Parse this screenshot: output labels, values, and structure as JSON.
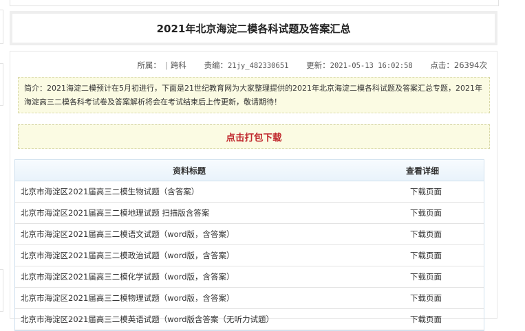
{
  "page": {
    "title": "2021年北京海淀二模各科试题及答案汇总"
  },
  "meta": {
    "belong_label": "所属：",
    "belong_value": "跨科",
    "editor_label": "责编：",
    "editor_value": "21jy_482330651",
    "updated_label": "更新：",
    "updated_value": "2021-05-13 16:02:58",
    "clicks_label": "点击：",
    "clicks_value": "26394次"
  },
  "intro": "简介：2021海淀二模预计在5月初进行，下面是21世纪教育网为大家整理提供的2021年北京海淀二模各科试题及答案汇总专题，2021年海淀高三二模各科考试卷及答案解析将会在考试结束后上传更新，敬请期待！",
  "download_label": "点击打包下载",
  "table": {
    "headers": [
      "资料标题",
      "查看详细"
    ],
    "rows": [
      {
        "title": "北京市海淀区2021届高三二模生物试题（含答案）",
        "action": "下载页面"
      },
      {
        "title": "北京市海淀区2021届高三二模地理试题 扫描版含答案",
        "action": "下载页面"
      },
      {
        "title": "北京市海淀区2021届高三二模语文试题（word版，含答案）",
        "action": "下载页面"
      },
      {
        "title": "北京市海淀区2021届高三二模政治试题（word版，含答案）",
        "action": "下载页面"
      },
      {
        "title": "北京市海淀区2021届高三二模化学试题（word版，含答案）",
        "action": "下载页面"
      },
      {
        "title": "北京市海淀区2021届高三二模物理试题（word版，含答案）",
        "action": "下载页面"
      },
      {
        "title": "北京市海淀区2021届高三二模英语试题（word版含答案（无听力试题）",
        "action": "下载页面"
      }
    ]
  }
}
